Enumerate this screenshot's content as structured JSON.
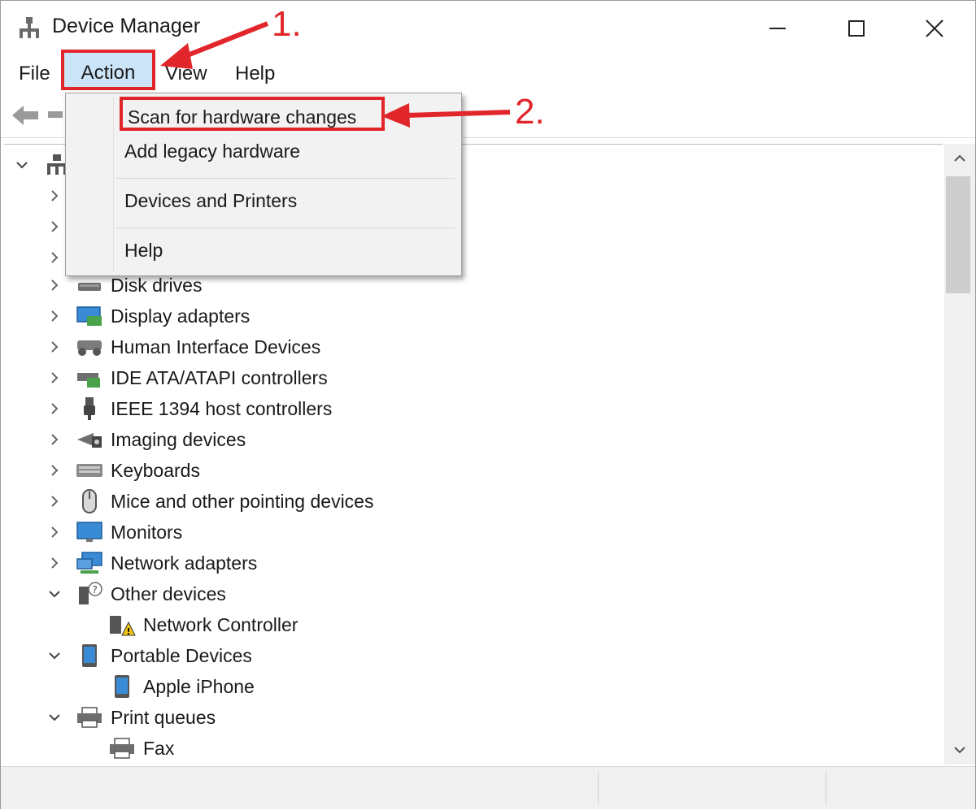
{
  "window": {
    "title": "Device Manager",
    "controls": {
      "minimize": "minimize-icon",
      "maximize": "maximize-icon",
      "close": "close-icon"
    }
  },
  "menu": {
    "file": "File",
    "action": "Action",
    "view": "View",
    "help": "Help"
  },
  "action_menu": {
    "items": [
      "Scan for hardware changes",
      "Add legacy hardware",
      "Devices and Printers",
      "Help"
    ]
  },
  "annotations": {
    "step1": "1.",
    "step2": "2."
  },
  "tree": {
    "items": [
      {
        "label": "Disk drives",
        "state": "collapsed",
        "icon": "disk-drive-icon"
      },
      {
        "label": "Display adapters",
        "state": "collapsed",
        "icon": "display-adapter-icon"
      },
      {
        "label": "Human Interface Devices",
        "state": "collapsed",
        "icon": "hid-icon"
      },
      {
        "label": "IDE ATA/ATAPI controllers",
        "state": "collapsed",
        "icon": "ide-controller-icon"
      },
      {
        "label": "IEEE 1394 host controllers",
        "state": "collapsed",
        "icon": "firewire-icon"
      },
      {
        "label": "Imaging devices",
        "state": "collapsed",
        "icon": "camera-icon"
      },
      {
        "label": "Keyboards",
        "state": "collapsed",
        "icon": "keyboard-icon"
      },
      {
        "label": "Mice and other pointing devices",
        "state": "collapsed",
        "icon": "mouse-icon"
      },
      {
        "label": "Monitors",
        "state": "collapsed",
        "icon": "monitor-icon"
      },
      {
        "label": "Network adapters",
        "state": "collapsed",
        "icon": "network-adapter-icon"
      },
      {
        "label": "Other devices",
        "state": "expanded",
        "icon": "unknown-device-icon"
      },
      {
        "label": "Network Controller",
        "state": "child",
        "icon": "warning-device-icon"
      },
      {
        "label": "Portable Devices",
        "state": "expanded",
        "icon": "portable-device-icon"
      },
      {
        "label": "Apple iPhone",
        "state": "child",
        "icon": "phone-icon"
      },
      {
        "label": "Print queues",
        "state": "expanded",
        "icon": "printer-icon"
      },
      {
        "label": "Fax",
        "state": "child",
        "icon": "fax-icon"
      }
    ]
  },
  "colors": {
    "highlight_border": "#e1262b",
    "menu_selected": "#cce4f7"
  }
}
